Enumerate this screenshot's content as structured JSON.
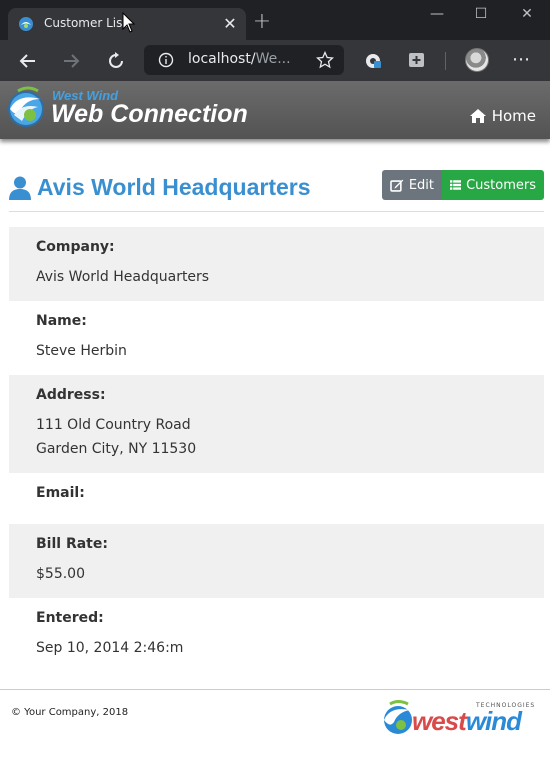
{
  "browser": {
    "tab_title": "Customer List",
    "url_host": "localhost/",
    "url_path": "We...",
    "new_tab_glyph": "+",
    "window_controls": {
      "minimize": "—",
      "maximize": "☐",
      "close": "✕"
    },
    "menu_glyph": "⋯"
  },
  "header": {
    "brand_top": "West Wind",
    "brand_main": "Web Connection",
    "home_label": "Home"
  },
  "page": {
    "title": "Avis World Headquarters",
    "edit_label": "Edit",
    "customers_label": "Customers"
  },
  "fields": [
    {
      "label": "Company:",
      "lines": [
        "Avis World Headquarters"
      ]
    },
    {
      "label": "Name:",
      "lines": [
        "Steve Herbin"
      ]
    },
    {
      "label": "Address:",
      "lines": [
        "111 Old Country Road",
        "Garden City, NY 11530"
      ]
    },
    {
      "label": "Email:",
      "lines": []
    },
    {
      "label": "Bill Rate:",
      "lines": [
        "$55.00"
      ]
    },
    {
      "label": "Entered:",
      "lines": [
        "Sep 10, 2014 2:46:m"
      ]
    }
  ],
  "footer": {
    "copyright": "© Your Company, 2018",
    "logo_west": "west",
    "logo_wind": "wind",
    "logo_sub": "TECHNOLOGIES"
  },
  "colors": {
    "accent": "#3a8fd0",
    "edit_button": "#6c757d",
    "customers_button": "#28a745",
    "header_bg": "#5e5e5e"
  }
}
